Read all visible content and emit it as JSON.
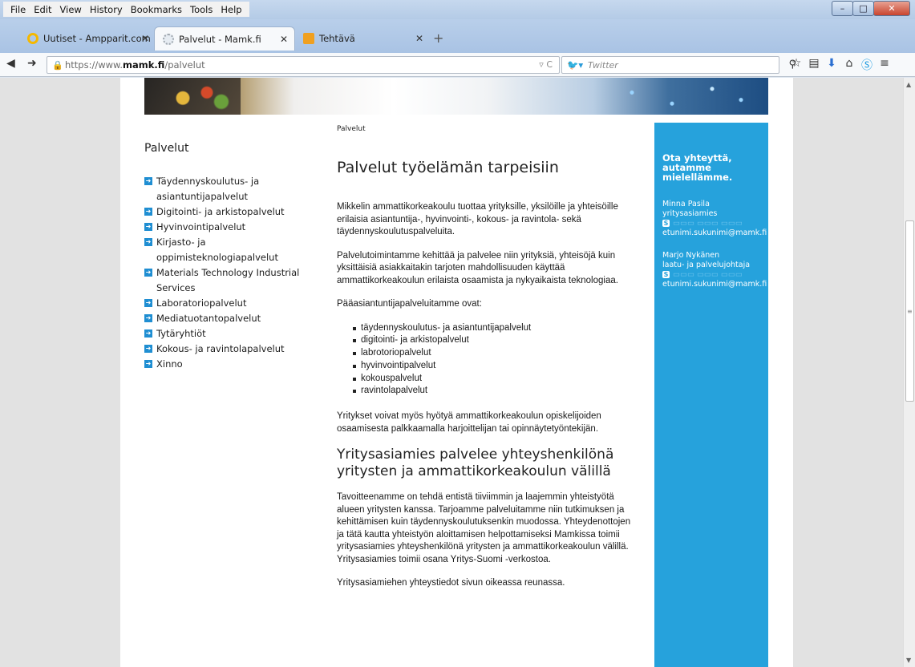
{
  "menubar": {
    "items": [
      "File",
      "Edit",
      "View",
      "History",
      "Bookmarks",
      "Tools",
      "Help"
    ]
  },
  "tabs": [
    {
      "title": "Uutiset - Ampparit.com - S..."
    },
    {
      "title": "Palvelut - Mamk.fi"
    },
    {
      "title": "Tehtävä"
    }
  ],
  "navbar": {
    "url_prefix": "https://www.",
    "url_domain": "mamk.fi",
    "url_path": "/palvelut",
    "search_engine": "Twitter",
    "search_placeholder": "Twitter"
  },
  "page": {
    "breadcrumb": "Palvelut",
    "leftnav": {
      "heading": "Palvelut",
      "items": [
        "Täydennyskoulutus- ja asiantuntijapalvelut",
        "Digitointi- ja arkistopalvelut",
        "Hyvinvointipalvelut",
        "Kirjasto- ja oppimisteknologiapalvelut",
        "Materials Technology Industrial Services",
        "Laboratoriopalvelut",
        "Mediatuotantopalvelut",
        "Tytäryhtiöt",
        "Kokous- ja ravintolapalvelut",
        "Xinno"
      ]
    },
    "main": {
      "title": "Palvelut työelämän tarpeisiin",
      "p1": "Mikkelin ammattikorkeakoulu tuottaa yrityksille, yksilöille ja yhteisöille erilaisia asiantuntija-, hyvinvointi-, kokous- ja ravintola- sekä täydennyskoulutuspalveluita.",
      "p2": "Palvelutoimintamme kehittää ja palvelee niin yrityksiä, yhteisöjä kuin yksittäisiä asiakkaitakin tarjoten mahdollisuuden käyttää ammattikorkeakoulun erilaista osaamista ja nykyaikaista teknologiaa.",
      "p3": "Pääasiantuntijapalveluitamme ovat:",
      "list": [
        "täydennyskoulutus- ja asiantuntijapalvelut",
        "digitointi- ja arkistopalvelut",
        "labrotoriopalvelut",
        "hyvinvointipalvelut",
        "kokouspalvelut",
        "ravintolapalvelut"
      ],
      "p4": "Yritykset voivat myös hyötyä ammattikorkeakoulun opiskelijoiden osaamisesta palkkaamalla harjoittelijan tai opinnäytetyöntekijän.",
      "subtitle": "Yritysasiamies palvelee yhteyshenkilönä yritysten ja ammattikorkeakoulun välillä",
      "p5": "Tavoitteenamme on tehdä entistä tiiviimmin ja laajemmin yhteistyötä alueen yritysten kanssa. Tarjoamme palveluitamme niin tutkimuksen ja kehittämisen kuin täydennyskoulutuksenkin muodossa. Yhteydenottojen ja tätä kautta yhteistyön aloittamisen helpottamiseksi Mamkissa toimii yritysasiamies yhteyshenkilönä yritysten ja ammattikorkeakoulun välillä. Yritysasiamies toimii osana Yritys-Suomi -verkostoa.",
      "p6": "Yritysasiamiehen yhteystiedot sivun oikeassa reunassa."
    },
    "sidebox": {
      "heading": "Ota yhteyttä, autamme mielellämme.",
      "contacts": [
        {
          "name": "Minna Pasila",
          "role": "yritysasiamies",
          "email": "etunimi.sukunimi@mamk.fi"
        },
        {
          "name": "Marjo Nykänen",
          "role": "laatu- ja palvelujohtaja",
          "email": "etunimi.sukunimi@mamk.fi"
        }
      ]
    }
  },
  "colors": {
    "accent": "#26a2dc",
    "arrow": "#1f8ed2"
  }
}
